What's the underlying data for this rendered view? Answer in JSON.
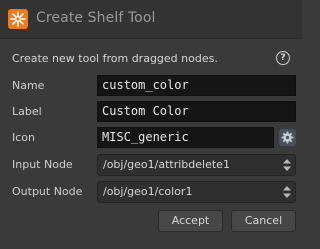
{
  "window": {
    "title": "Create Shelf Tool"
  },
  "description": "Create new tool from dragged nodes.",
  "form": {
    "name": {
      "label": "Name",
      "value": "custom_color"
    },
    "label": {
      "label": "Label",
      "value": "Custom Color"
    },
    "icon": {
      "label": "Icon",
      "value": "MISC_generic"
    },
    "input_node": {
      "label": "Input Node",
      "value": "/obj/geo1/attribdelete1"
    },
    "output_node": {
      "label": "Output Node",
      "value": "/obj/geo1/color1"
    }
  },
  "buttons": {
    "accept": "Accept",
    "cancel": "Cancel"
  },
  "help_glyph": "?",
  "colors": {
    "app_icon": "#f07a1a",
    "field_bg": "#151515",
    "dialog_bg": "#3a3a3a"
  }
}
